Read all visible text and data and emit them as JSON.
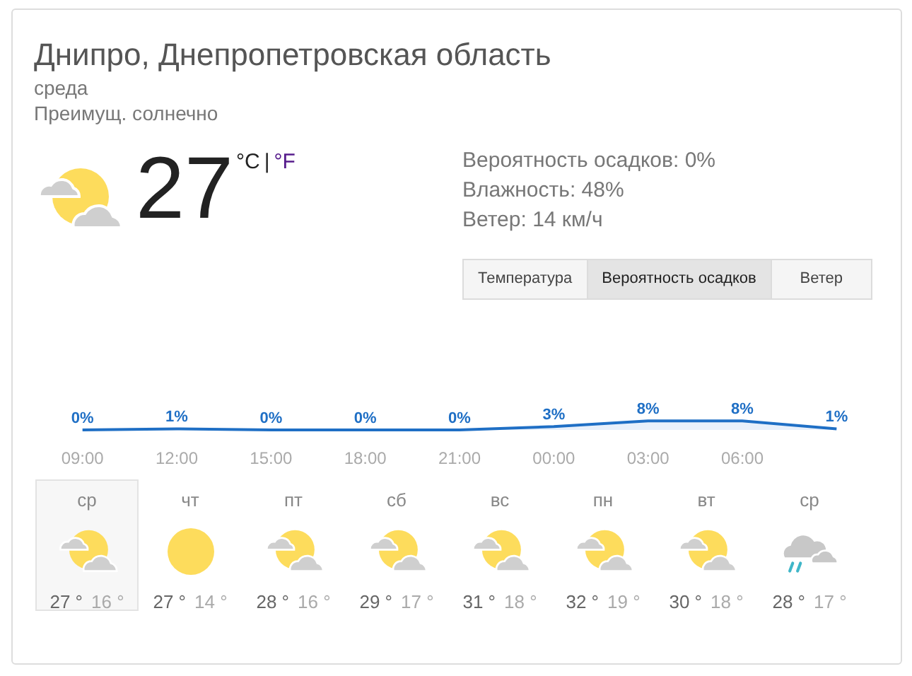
{
  "location": "Днипро, Днепропетровская область",
  "day": "среда",
  "condition": "Преимущ. солнечно",
  "current": {
    "kind": "partly-cloudy",
    "temperature": "27",
    "units": [
      {
        "label": "°C",
        "selected": true
      },
      {
        "label": "°F",
        "selected": false
      }
    ],
    "separator": "|"
  },
  "details": [
    "Вероятность осадков: 0%",
    "Влажность: 48%",
    "Ветер: 14 км/ч"
  ],
  "tabs": [
    {
      "label": "Температура",
      "selected": false
    },
    {
      "label": "Вероятность осадков",
      "selected": true
    },
    {
      "label": "Ветер",
      "selected": false
    }
  ],
  "precipitation": {
    "value_suffix": "%",
    "chart_data": {
      "type": "area",
      "data_labels": true,
      "categories": [
        "09:00",
        "12:00",
        "15:00",
        "18:00",
        "21:00",
        "00:00",
        "03:00",
        "06:00",
        null
      ],
      "series": [
        {
          "color": "#1f6fc5",
          "values": [
            0,
            1,
            0,
            0,
            0,
            3,
            8,
            8,
            1
          ]
        }
      ]
    }
  },
  "days": [
    {
      "name": "ср",
      "kind": "partly-cloudy",
      "high": "27 °",
      "low": "16 °",
      "selected": true
    },
    {
      "name": "чт",
      "kind": "sunny",
      "high": "27 °",
      "low": "14 °",
      "selected": false
    },
    {
      "name": "пт",
      "kind": "partly-cloudy",
      "high": "28 °",
      "low": "16 °",
      "selected": false
    },
    {
      "name": "сб",
      "kind": "partly-cloudy",
      "high": "29 °",
      "low": "17 °",
      "selected": false
    },
    {
      "name": "вс",
      "kind": "partly-cloudy",
      "high": "31 °",
      "low": "18 °",
      "selected": false
    },
    {
      "name": "пн",
      "kind": "partly-cloudy",
      "high": "32 °",
      "low": "19 °",
      "selected": false
    },
    {
      "name": "вт",
      "kind": "partly-cloudy",
      "high": "30 °",
      "low": "18 °",
      "selected": false
    },
    {
      "name": "ср",
      "kind": "rain",
      "high": "28 °",
      "low": "17 °",
      "selected": false
    }
  ]
}
